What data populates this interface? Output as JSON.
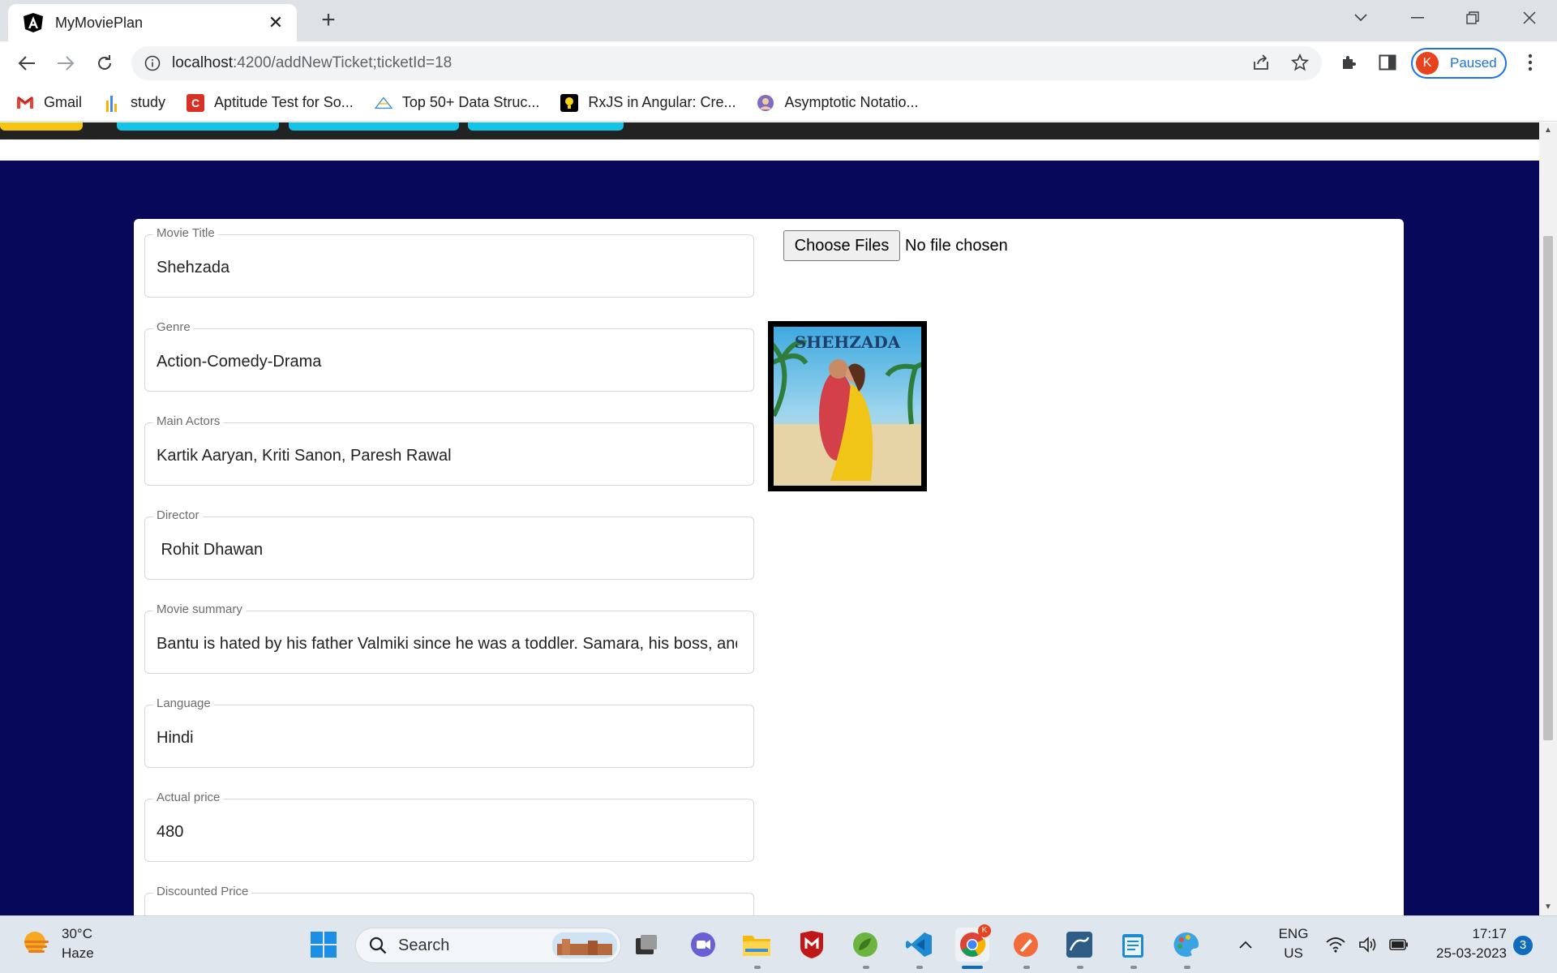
{
  "browser": {
    "tab_title": "MyMoviePlan",
    "url_host": "localhost",
    "url_path": ":4200/addNewTicket;ticketId=18",
    "profile_initial": "K",
    "profile_status": "Paused",
    "bookmarks": [
      {
        "label": "Gmail",
        "icon": "gmail-icon"
      },
      {
        "label": "study",
        "icon": "study-icon"
      },
      {
        "label": "Aptitude Test for So...",
        "icon": "c-icon"
      },
      {
        "label": "Top 50+ Data Struc...",
        "icon": "ds-icon"
      },
      {
        "label": "RxJS in Angular: Cre...",
        "icon": "bulb-icon"
      },
      {
        "label": "Asymptotic Notatio...",
        "icon": "avatar-icon"
      }
    ]
  },
  "form": {
    "fields": [
      {
        "label": "Movie Title",
        "value": "Shehzada"
      },
      {
        "label": "Genre",
        "value": "Action-Comedy-Drama"
      },
      {
        "label": "Main Actors",
        "value": "Kartik Aaryan, Kriti Sanon, Paresh Rawal"
      },
      {
        "label": "Director",
        "value": " Rohit Dhawan"
      },
      {
        "label": "Movie summary",
        "value": "Bantu is hated by his father Valmiki since he was a toddler. Samara, his boss, and"
      },
      {
        "label": "Language",
        "value": "Hindi"
      },
      {
        "label": "Actual price",
        "value": "480"
      },
      {
        "label": "Discounted Price",
        "value": ""
      }
    ],
    "file_button": "Choose Files",
    "file_status": "No file chosen",
    "poster_title": "SHEHZADA"
  },
  "taskbar": {
    "temperature": "30°C",
    "weather": "Haze",
    "search_placeholder": "Search",
    "lang_top": "ENG",
    "lang_bottom": "US",
    "time": "17:17",
    "date": "25-03-2023",
    "notification_count": "3"
  },
  "colors": {
    "page_band": "#08085a",
    "accent": "#1a73e8",
    "nav_pill_yellow": "#f7c510",
    "nav_pill_cyan": "#12c4e8"
  }
}
